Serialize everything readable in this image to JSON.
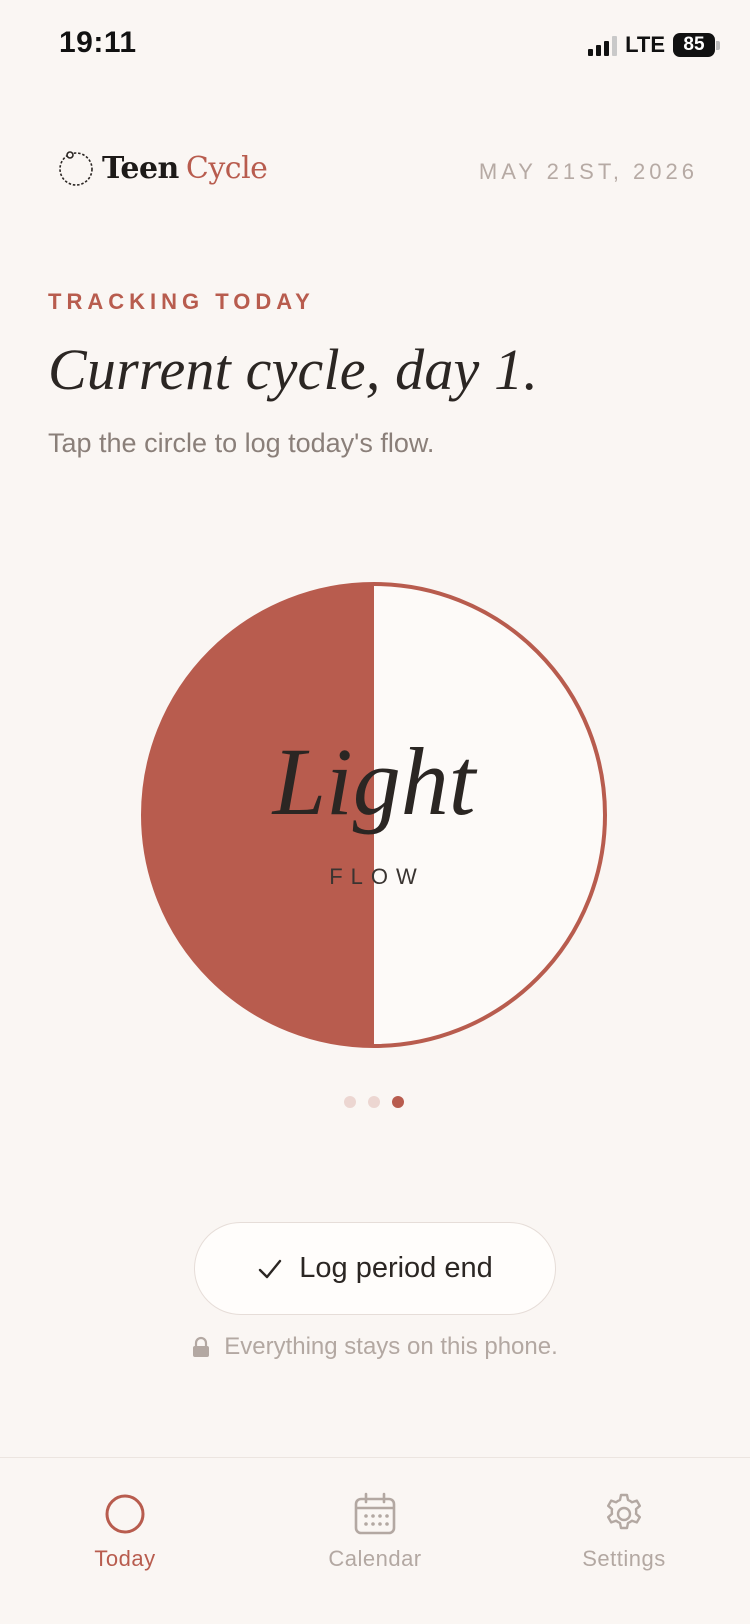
{
  "status_bar": {
    "time": "19:11",
    "network": "LTE",
    "battery": "85"
  },
  "header": {
    "brand_first": "Teen",
    "brand_second": "Cycle",
    "date": "MAY 21ST, 2026"
  },
  "main": {
    "eyebrow": "TRACKING TODAY",
    "title": "Current cycle, day 1.",
    "subtitle": "Tap the circle to log today's flow.",
    "flow": {
      "label": "Light",
      "caption": "FLOW",
      "fill_fraction": 0.5,
      "level_index": 3,
      "level_count": 3
    },
    "action_button": "Log period end",
    "privacy_note": "Everything stays on this phone."
  },
  "tabs": [
    {
      "label": "Today",
      "icon": "circle-icon",
      "active": true
    },
    {
      "label": "Calendar",
      "icon": "calendar-icon",
      "active": false
    },
    {
      "label": "Settings",
      "icon": "gear-icon",
      "active": false
    }
  ],
  "colors": {
    "accent": "#b85c4e",
    "background": "#faf6f3",
    "muted_text": "#b3a8a2",
    "dot_inactive": "#ecd6d1"
  }
}
